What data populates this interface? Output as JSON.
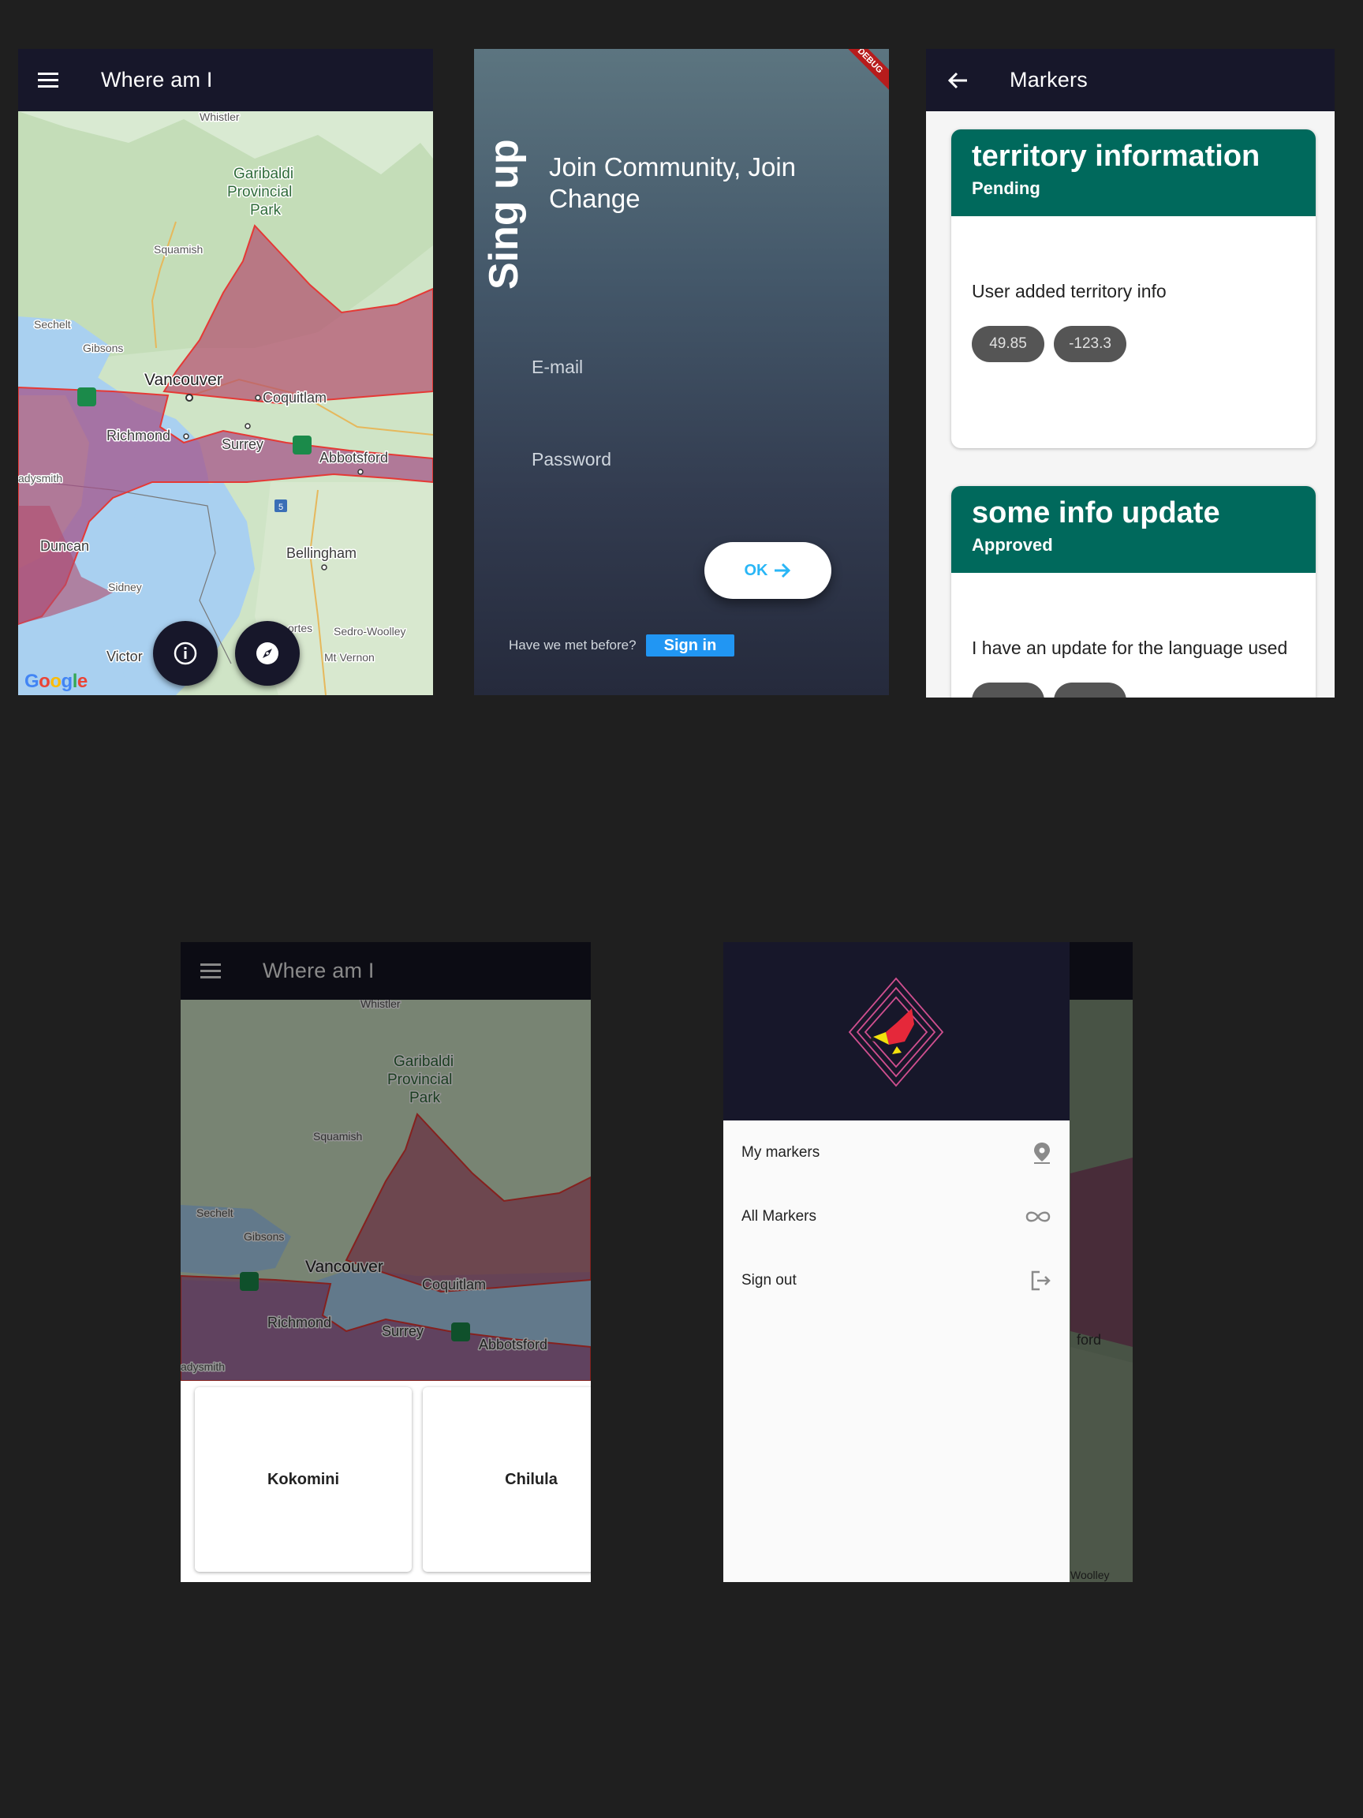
{
  "screen_map": {
    "title": "Where am I",
    "labels": {
      "whistler": "Whistler",
      "garibaldi1": "Garibaldi",
      "garibaldi2": "Provincial",
      "garibaldi3": "Park",
      "squamish": "Squamish",
      "sechelt": "Sechelt",
      "gibsons": "Gibsons",
      "vancouver": "Vancouver",
      "coquitlam": "Coquitlam",
      "richmond": "Richmond",
      "surrey": "Surrey",
      "abbotsford": "Abbotsford",
      "ladysmith": "adysmith",
      "duncan": "Duncan",
      "bellingham": "Bellingham",
      "sidney": "Sidney",
      "anacortes": "ortes",
      "sedro": "Sedro-Woolley",
      "vernon": "Mt Vernon",
      "victoria": "Victor",
      "hw5": "5"
    },
    "google": [
      "G",
      "o",
      "o",
      "g",
      "l",
      "e"
    ]
  },
  "screen_signup": {
    "vertical_title": "Sing up",
    "tagline": "Join Community, Join Change",
    "email_label": "E-mail",
    "password_label": "Password",
    "ok_label": "OK",
    "met_text": "Have we met before?",
    "signin_label": "Sign in",
    "debug_label": "DEBUG"
  },
  "screen_markers": {
    "title": "Markers",
    "cards": [
      {
        "title": "territory information",
        "status": "Pending",
        "description": "User added territory info",
        "lat": "49.85",
        "lng": "-123.3"
      },
      {
        "title": "some info update",
        "status": "Approved",
        "description": "I have an update for the language used",
        "lat": "",
        "lng": ""
      }
    ]
  },
  "screen_map_cards": {
    "title": "Where am I",
    "cards": [
      "Kokomini",
      "Chilula"
    ]
  },
  "screen_drawer": {
    "items": [
      {
        "label": "My markers",
        "icon": "location-pin-icon"
      },
      {
        "label": "All Markers",
        "icon": "infinity-icon"
      },
      {
        "label": "Sign out",
        "icon": "logout-icon"
      }
    ]
  }
}
